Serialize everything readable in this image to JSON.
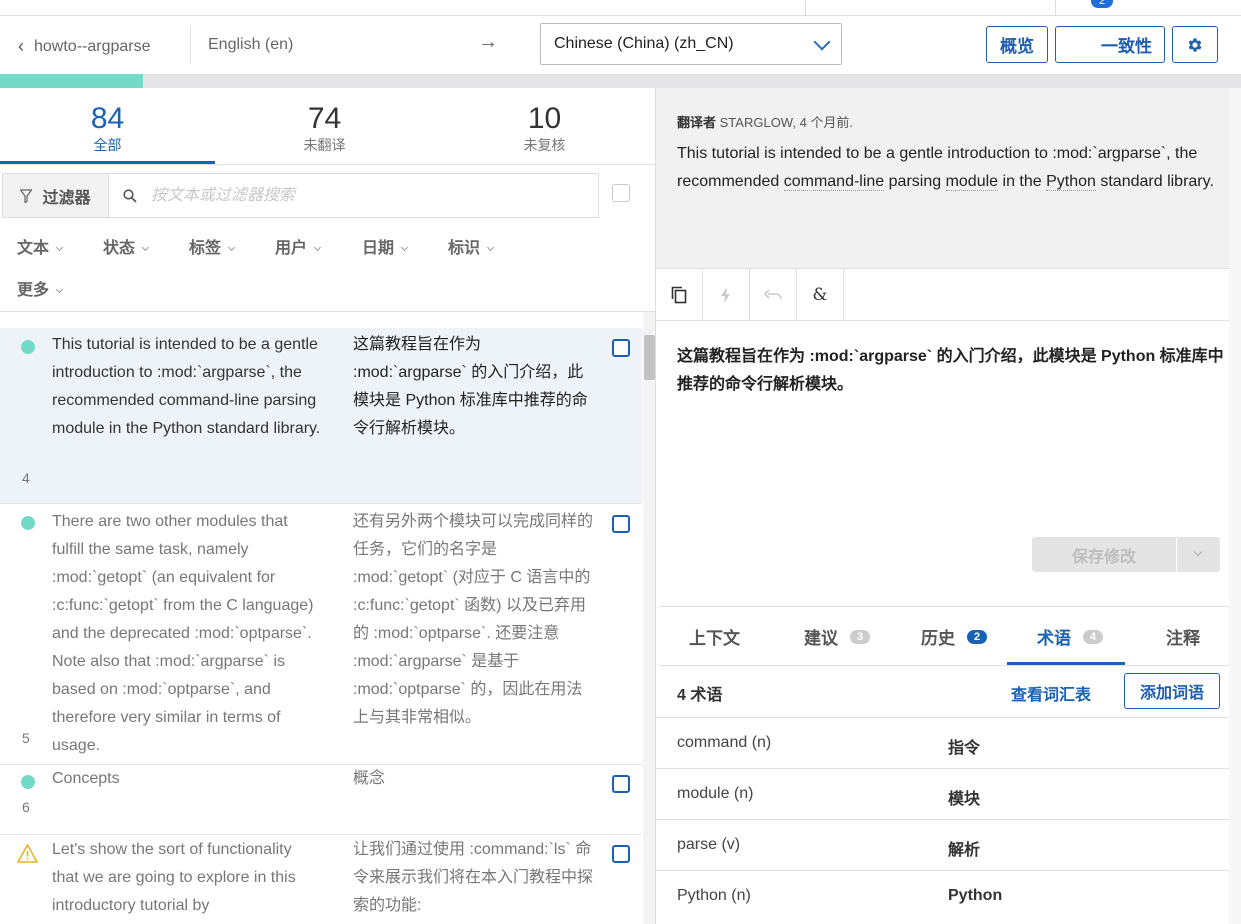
{
  "topstrip": {
    "badge": "2"
  },
  "header": {
    "back_label": "howto--argparse",
    "source_language": "English (en)",
    "arrow": "→",
    "target_language": "Chinese (China) (zh_CN)",
    "overview_label": "概览",
    "consistency_label": "一致性"
  },
  "progress": {
    "fraction": 0.115
  },
  "stats": [
    {
      "num": "84",
      "label": "全部"
    },
    {
      "num": "74",
      "label": "未翻译"
    },
    {
      "num": "10",
      "label": "未复核"
    }
  ],
  "filter": {
    "button_label": "过滤器",
    "search_placeholder": "按文本或过滤器搜索",
    "dropdowns": [
      "文本",
      "状态",
      "标签",
      "用户",
      "日期",
      "标识",
      "更多"
    ]
  },
  "units": [
    {
      "number": "4",
      "status": "translated",
      "source": "This tutorial is intended to be a gentle introduction to :mod:`argparse`, the recommended command-line parsing module in the Python standard library.",
      "target": "这篇教程旨在作为 :mod:`argparse` 的入门介绍，此模块是 Python 标准库中推荐的命令行解析模块。"
    },
    {
      "number": "5",
      "status": "translated",
      "source": "There are two other modules that fulfill the same task, namely :mod:`getopt` (an equivalent for :c:func:`getopt` from the C language) and the deprecated :mod:`optparse`. Note also that :mod:`argparse` is based on :mod:`optparse`, and therefore very similar in terms of usage.",
      "target": "还有另外两个模块可以完成同样的任务，它们的名字是 :mod:`getopt` (对应于 C 语言中的 :c:func:`getopt` 函数) 以及已弃用的 :mod:`optparse`. 还要注意 :mod:`argparse` 是基于 :mod:`optparse` 的，因此在用法上与其非常相似。"
    },
    {
      "number": "6",
      "status": "translated",
      "source": "Concepts",
      "target": "概念"
    },
    {
      "number": "",
      "status": "warning",
      "source": "Let's show the sort of functionality that we are going to explore in this introductory tutorial by",
      "target": "让我们通过使用 :command:`ls` 命令来展示我们将在本入门教程中探索的功能:"
    }
  ],
  "editor": {
    "meta_prefix": "翻译者",
    "meta_user": "STARGLOW",
    "meta_time": ", 4 个月前.",
    "source_parts": [
      "This tutorial is intended to be a gentle introduction to :mod:`argparse`, the recommended ",
      "command-line",
      " parsing ",
      "module",
      " in the ",
      "Python",
      " standard library."
    ],
    "translation": "这篇教程旨在作为 :mod:`argparse` 的入门介绍，此模块是 Python 标准库中推荐的命令行解析模块。",
    "save_label": "保存修改"
  },
  "tabs": [
    {
      "label": "上下文",
      "count": ""
    },
    {
      "label": "建议",
      "count": "3"
    },
    {
      "label": "历史",
      "count": "2"
    },
    {
      "label": "术语",
      "count": "4"
    },
    {
      "label": "注释",
      "count": ""
    }
  ],
  "glossary": {
    "count_label": "4 术语",
    "view_label": "查看词汇表",
    "add_label": "添加词语",
    "entries": [
      {
        "term": "command (n)",
        "translation": "指令"
      },
      {
        "term": "module (n)",
        "translation": "模块"
      },
      {
        "term": "parse (v)",
        "translation": "解析"
      },
      {
        "term": "Python (n)",
        "translation": "Python"
      }
    ]
  },
  "colors": {
    "accent": "#1a62b3",
    "translated_dot": "#73dac8",
    "warning": "#e6b422"
  }
}
